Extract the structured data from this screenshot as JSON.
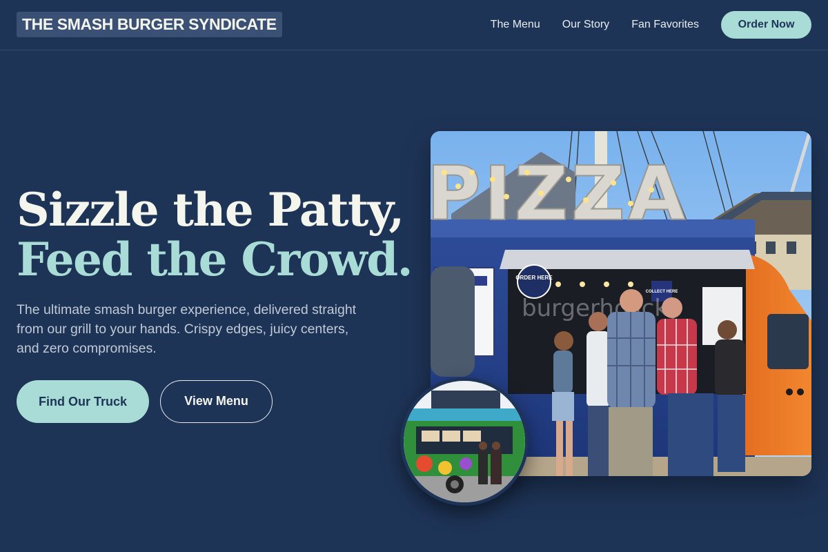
{
  "brand": {
    "name": "THE SMASH BURGER SYNDICATE"
  },
  "nav": {
    "links": [
      "The Menu",
      "Our Story",
      "Fan Favorites"
    ],
    "cta": "Order Now"
  },
  "hero": {
    "title_line1": "Sizzle the Patty,",
    "title_line2": "Feed the Crowd.",
    "subtitle": "The ultimate smash burger experience, delivered straight from our grill to your hands. Crispy edges, juicy centers, and zero compromises.",
    "primary_cta": "Find Our Truck",
    "secondary_cta": "View Menu"
  },
  "photo": {
    "sign_text": "PIZZA",
    "order_sign": "ORDER HERE",
    "collect_sign": "COLLECT HERE",
    "watermark": "burgerholicky"
  },
  "colors": {
    "background": "#1e3457",
    "accent": "#a9dcd6",
    "text": "#f4f6ee"
  }
}
